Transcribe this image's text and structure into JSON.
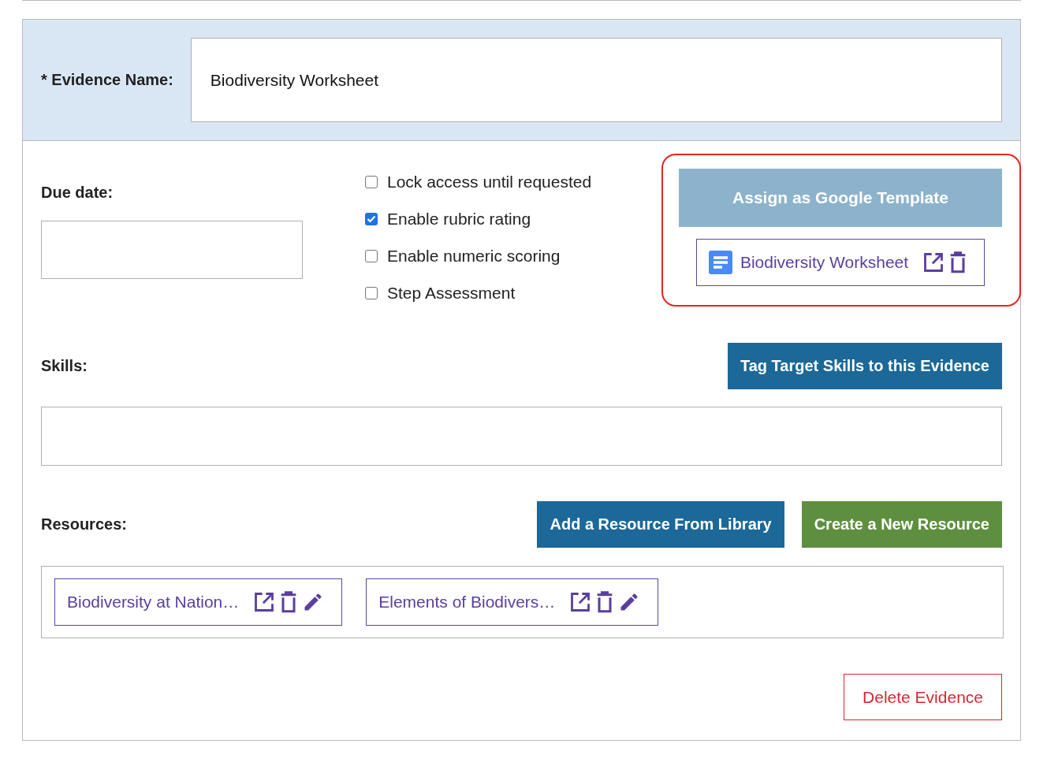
{
  "evidence_name": {
    "label": "* Evidence Name:",
    "value": "Biodiversity Worksheet"
  },
  "due_date": {
    "label": "Due date:"
  },
  "options": [
    {
      "label": "Lock access until requested",
      "checked": false
    },
    {
      "label": "Enable rubric rating",
      "checked": true
    },
    {
      "label": "Enable numeric scoring",
      "checked": false
    },
    {
      "label": "Step Assessment",
      "checked": false
    }
  ],
  "google_template": {
    "button": "Assign as Google Template",
    "file": "Biodiversity Worksheet"
  },
  "skills": {
    "label": "Skills:",
    "button": "Tag Target Skills to this Evidence"
  },
  "resources": {
    "label": "Resources:",
    "buttons": [
      {
        "label": "Add a Resource From Library",
        "kind": "library"
      },
      {
        "label": "Create a New Resource",
        "kind": "create"
      }
    ],
    "items": [
      {
        "title": "Biodiversity at Nation…"
      },
      {
        "title": "Elements of Biodivers…"
      }
    ]
  },
  "delete_button": "Delete Evidence"
}
